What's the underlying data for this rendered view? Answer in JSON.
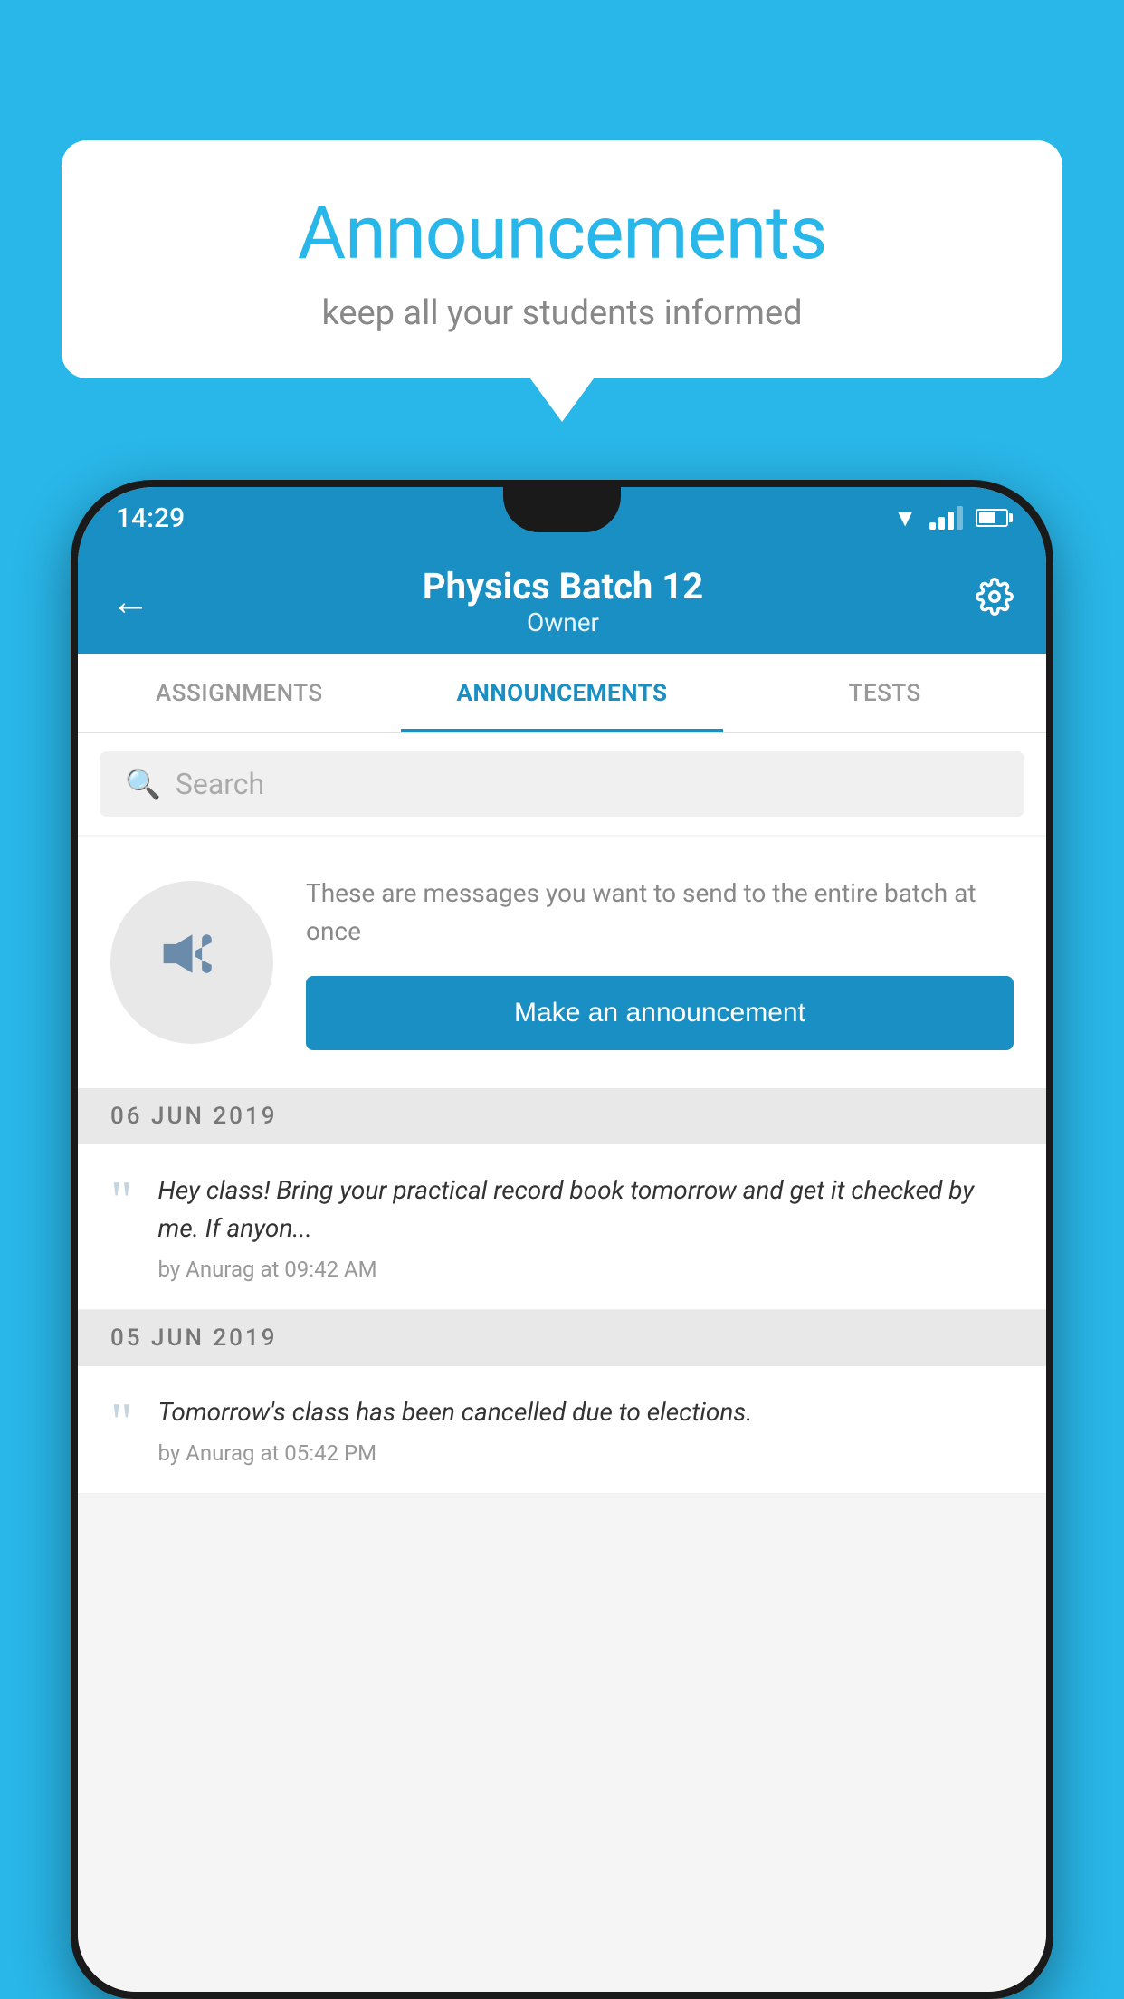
{
  "background_color": "#29b6e8",
  "speech_bubble": {
    "title": "Announcements",
    "subtitle": "keep all your students informed"
  },
  "status_bar": {
    "time": "14:29"
  },
  "header": {
    "title": "Physics Batch 12",
    "subtitle": "Owner",
    "back_label": "←",
    "settings_label": "⚙"
  },
  "tabs": [
    {
      "label": "ASSIGNMENTS",
      "active": false
    },
    {
      "label": "ANNOUNCEMENTS",
      "active": true
    },
    {
      "label": "TESTS",
      "active": false
    }
  ],
  "search": {
    "placeholder": "Search"
  },
  "announcement_prompt": {
    "description": "These are messages you want to send to the entire batch at once",
    "button_label": "Make an announcement"
  },
  "announcements": [
    {
      "date": "06  JUN  2019",
      "text": "Hey class! Bring your practical record book tomorrow and get it checked by me. If anyon...",
      "meta": "by Anurag at 09:42 AM"
    },
    {
      "date": "05  JUN  2019",
      "text": "Tomorrow's class has been cancelled due to elections.",
      "meta": "by Anurag at 05:42 PM"
    }
  ]
}
